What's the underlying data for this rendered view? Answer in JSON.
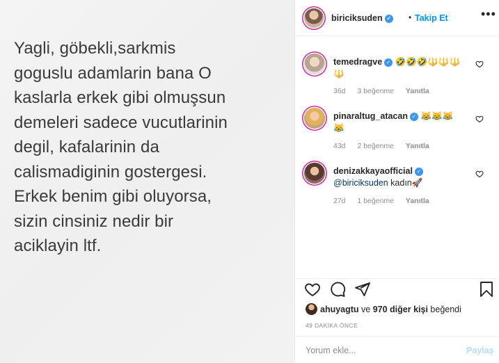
{
  "post": {
    "text": "Yagli, göbekli,sarkmis\ngoguslu adamlarin bana O\nkaslarla erkek gibi olmuşsun\ndemeleri sadece vucutlarinin\ndegil, kafalarinin da\ncalismadiginin gostergesi.\n  Erkek benim gibi oluyorsa,\nsizin cinsiniz nedir bir\naciklayin ltf."
  },
  "header": {
    "username": "biriciksuden",
    "separator": "•",
    "follow_label": "Takip Et",
    "more_label": "•••"
  },
  "comments": [
    {
      "username": "temedragve",
      "text": "🤣🤣🤣🔱🔱🔱\n🔱",
      "age": "36d",
      "likes": "3 beğenme",
      "reply": "Yanıtla"
    },
    {
      "username": "pinaraltug_atacan",
      "text": "😹😹😹\n😹",
      "age": "43d",
      "likes": "2 beğenme",
      "reply": "Yanıtla"
    },
    {
      "username": "denizakkayaofficial",
      "mention": "@biriciksuden",
      "text": " kadın🚀",
      "age": "27d",
      "likes": "1 beğenme",
      "reply": "Yanıtla"
    }
  ],
  "likes": {
    "first_user": "ahuyagtu",
    "middle": " ve ",
    "others": "970 diğer kişi",
    "suffix": " beğendi"
  },
  "timestamp": "49 DAKİKA ÖNCE",
  "add_comment": {
    "placeholder": "Yorum ekle...",
    "share_label": "Paylaş"
  },
  "icons": {
    "like": "heart-icon",
    "comment": "comment-icon",
    "share": "paper-plane-icon",
    "save": "bookmark-icon",
    "verified": "verified-badge-icon"
  },
  "colors": {
    "accent": "#0095f6",
    "verified": "#3897f0",
    "muted": "#8e8e8e",
    "share_disabled": "#b2dffc"
  }
}
